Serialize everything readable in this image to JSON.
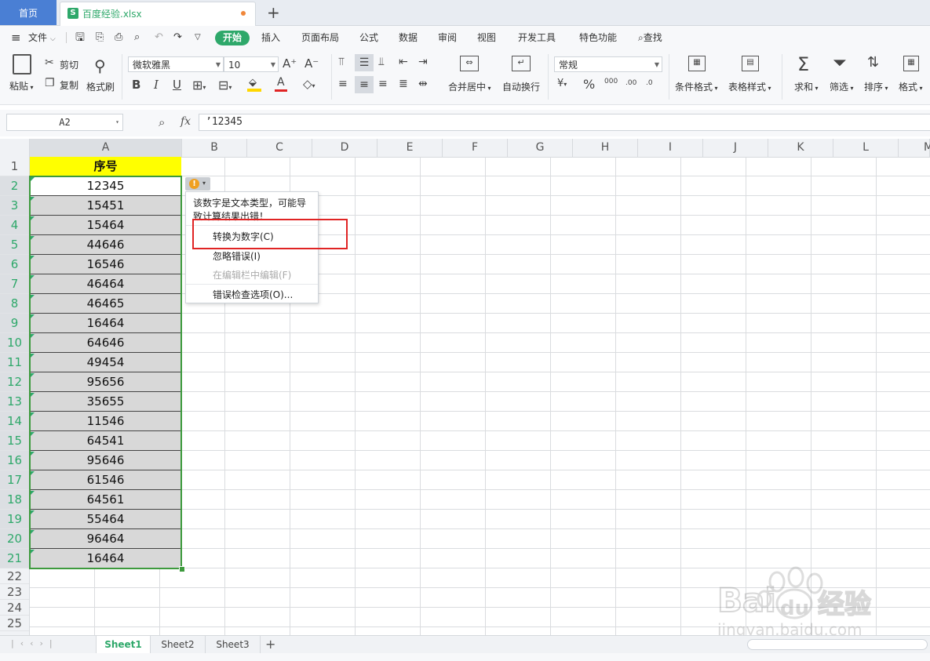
{
  "tabs": {
    "home": "首页",
    "file_name": "百度经验.xlsx",
    "file_icon": "S",
    "new_tab": "+"
  },
  "menu": {
    "hamburger": "≡",
    "file": "文件",
    "items": [
      "开始",
      "插入",
      "页面布局",
      "公式",
      "数据",
      "审阅",
      "视图",
      "开发工具",
      "特色功能"
    ],
    "search": "查找"
  },
  "ribbon": {
    "paste": "粘贴",
    "cut": "剪切",
    "copy": "复制",
    "format_painter": "格式刷",
    "font_name": "微软雅黑",
    "font_size": "10",
    "grow": "A⁺",
    "shrink": "A⁻",
    "bold": "B",
    "italic": "I",
    "underline": "U",
    "font_color_letter": "A",
    "merge_center": "合并居中",
    "wrap_text": "自动换行",
    "number_format": "常规",
    "percent": "%",
    "thousands": "000",
    "dec_inc": ".00",
    "dec_dec": ".0",
    "conditional_format": "条件格式",
    "table_style": "表格样式",
    "sum": "求和",
    "filter": "筛选",
    "sort": "排序",
    "format": "格式",
    "colors": {
      "font_color": "#e02424",
      "fill_color": "#ffd700"
    }
  },
  "formula_bar": {
    "name_box": "A2",
    "fx": "fx",
    "formula": "’12345"
  },
  "columns": [
    "A",
    "B",
    "C",
    "D",
    "E",
    "F",
    "G",
    "H",
    "I",
    "J",
    "K",
    "L",
    "M"
  ],
  "rows": [
    "1",
    "2",
    "3",
    "4",
    "5",
    "6",
    "7",
    "8",
    "9",
    "10",
    "11",
    "12",
    "13",
    "14",
    "15",
    "16",
    "17",
    "18",
    "19",
    "20",
    "21",
    "22",
    "23",
    "24",
    "25"
  ],
  "cells": {
    "header": "序号",
    "values": [
      "12345",
      "15451",
      "15464",
      "44646",
      "16546",
      "46464",
      "46465",
      "16464",
      "64646",
      "49454",
      "95656",
      "35655",
      "11546",
      "64541",
      "95646",
      "61546",
      "64561",
      "55464",
      "96464",
      "16464"
    ]
  },
  "error_popup": {
    "button_icon": "!",
    "message": "该数字是文本类型，可能导致计算结果出错！",
    "items": [
      {
        "label": "转换为数字(C)",
        "enabled": true
      },
      {
        "label": "忽略错误(I)",
        "enabled": true
      },
      {
        "label": "在编辑栏中编辑(F)",
        "enabled": false
      },
      {
        "label": "错误检查选项(O)...",
        "enabled": true
      }
    ]
  },
  "sheet_tabs": [
    "Sheet1",
    "Sheet2",
    "Sheet3"
  ],
  "add_sheet": "+",
  "watermark": "Baidu经验 jingyan.baidu.com",
  "colors": {
    "accent": "#2ea86a",
    "header_fill": "#ffff00",
    "selection_border": "#3d9a3d",
    "highlight": "#e02424"
  }
}
